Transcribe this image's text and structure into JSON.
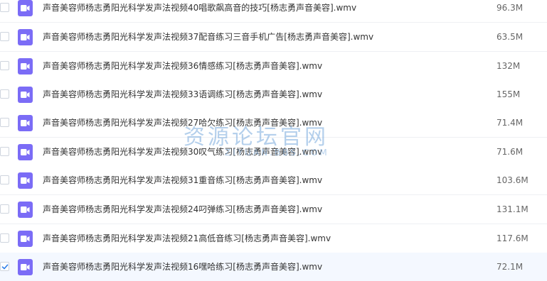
{
  "files": [
    {
      "name": "声音美容师杨志勇阳光科学发声法视频40唱歌飙高音的技巧[杨志勇声音美容].wmv",
      "size": "96.3M",
      "checked": false,
      "icon": "video-file-icon"
    },
    {
      "name": "声音美容师杨志勇阳光科学发声法视频37配音练习三音手机广告[杨志勇声音美容].wmv",
      "size": "63.5M",
      "checked": false,
      "icon": "video-file-icon"
    },
    {
      "name": "声音美容师杨志勇阳光科学发声法视频36情感练习[杨志勇声音美容].wmv",
      "size": "132M",
      "checked": false,
      "icon": "video-file-icon"
    },
    {
      "name": "声音美容师杨志勇阳光科学发声法视频33语调练习[杨志勇声音美容].wmv",
      "size": "155M",
      "checked": false,
      "icon": "video-file-icon"
    },
    {
      "name": "声音美容师杨志勇阳光科学发声法视频27哈欠练习[杨志勇声音美容].wmv",
      "size": "71.4M",
      "checked": false,
      "icon": "video-file-icon"
    },
    {
      "name": "声音美容师杨志勇阳光科学发声法视频30叹气练习[杨志勇声音美容].wmv",
      "size": "71.6M",
      "checked": false,
      "icon": "video-file-icon"
    },
    {
      "name": "声音美容师杨志勇阳光科学发声法视频31重音练习[杨志勇声音美容].wmv",
      "size": "103.6M",
      "checked": false,
      "icon": "video-file-icon"
    },
    {
      "name": "声音美容师杨志勇阳光科学发声法视频24叼弹练习[杨志勇声音美容].wmv",
      "size": "131.1M",
      "checked": false,
      "icon": "video-file-icon"
    },
    {
      "name": "声音美容师杨志勇阳光科学发声法视频21高低音练习[杨志勇声音美容].wmv",
      "size": "117.6M",
      "checked": false,
      "icon": "video-file-icon"
    },
    {
      "name": "声音美容师杨志勇阳光科学发声法视频16嘿哈练习[杨志勇声音美容].wmv",
      "size": "72.1M",
      "checked": true,
      "icon": "video-file-icon"
    }
  ],
  "watermark": {
    "title": "资源论坛官网",
    "subtitle": "ZIYUAN.BBS.COM"
  },
  "colors": {
    "icon_bg": "#7b6cf6",
    "check_mark": "#2b7de9",
    "selected_row_bg": "#f4f8ff",
    "watermark": "#78aadc"
  }
}
